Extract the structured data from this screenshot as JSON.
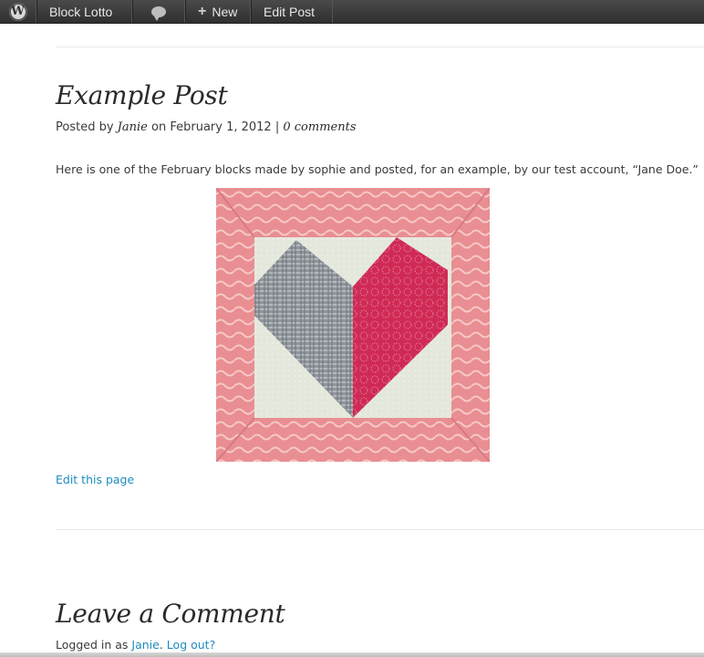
{
  "admin_bar": {
    "wp_logo_icon": "wordpress-logo-icon",
    "site_name": "Block Lotto",
    "comments_icon": "speech-bubble-icon",
    "new_plus": "+",
    "new_label": "New",
    "edit_label": "Edit Post",
    "bg_color": "#333333",
    "text_color": "#e8e8e8"
  },
  "post": {
    "title": "Example Post",
    "meta": {
      "prefix": "Posted by",
      "author": "Janie",
      "on": "on",
      "date": "February 1, 2012",
      "separator": "|",
      "comments": "0 comments"
    },
    "body": "Here is one of the February blocks made by sophie and posted, for an example, by our test account, “Jane Doe.”",
    "image_icon": "heart-quilt-block-image",
    "edit_link": "Edit this page"
  },
  "comments_section": {
    "title": "Leave a Comment",
    "logged_in_prefix": "Logged in as",
    "user": "Janie",
    "sep": ".",
    "logout": "Log out?"
  },
  "colors": {
    "link": "#1e8cbe",
    "text": "#3a3a3a",
    "heading": "#2a2a2a"
  }
}
